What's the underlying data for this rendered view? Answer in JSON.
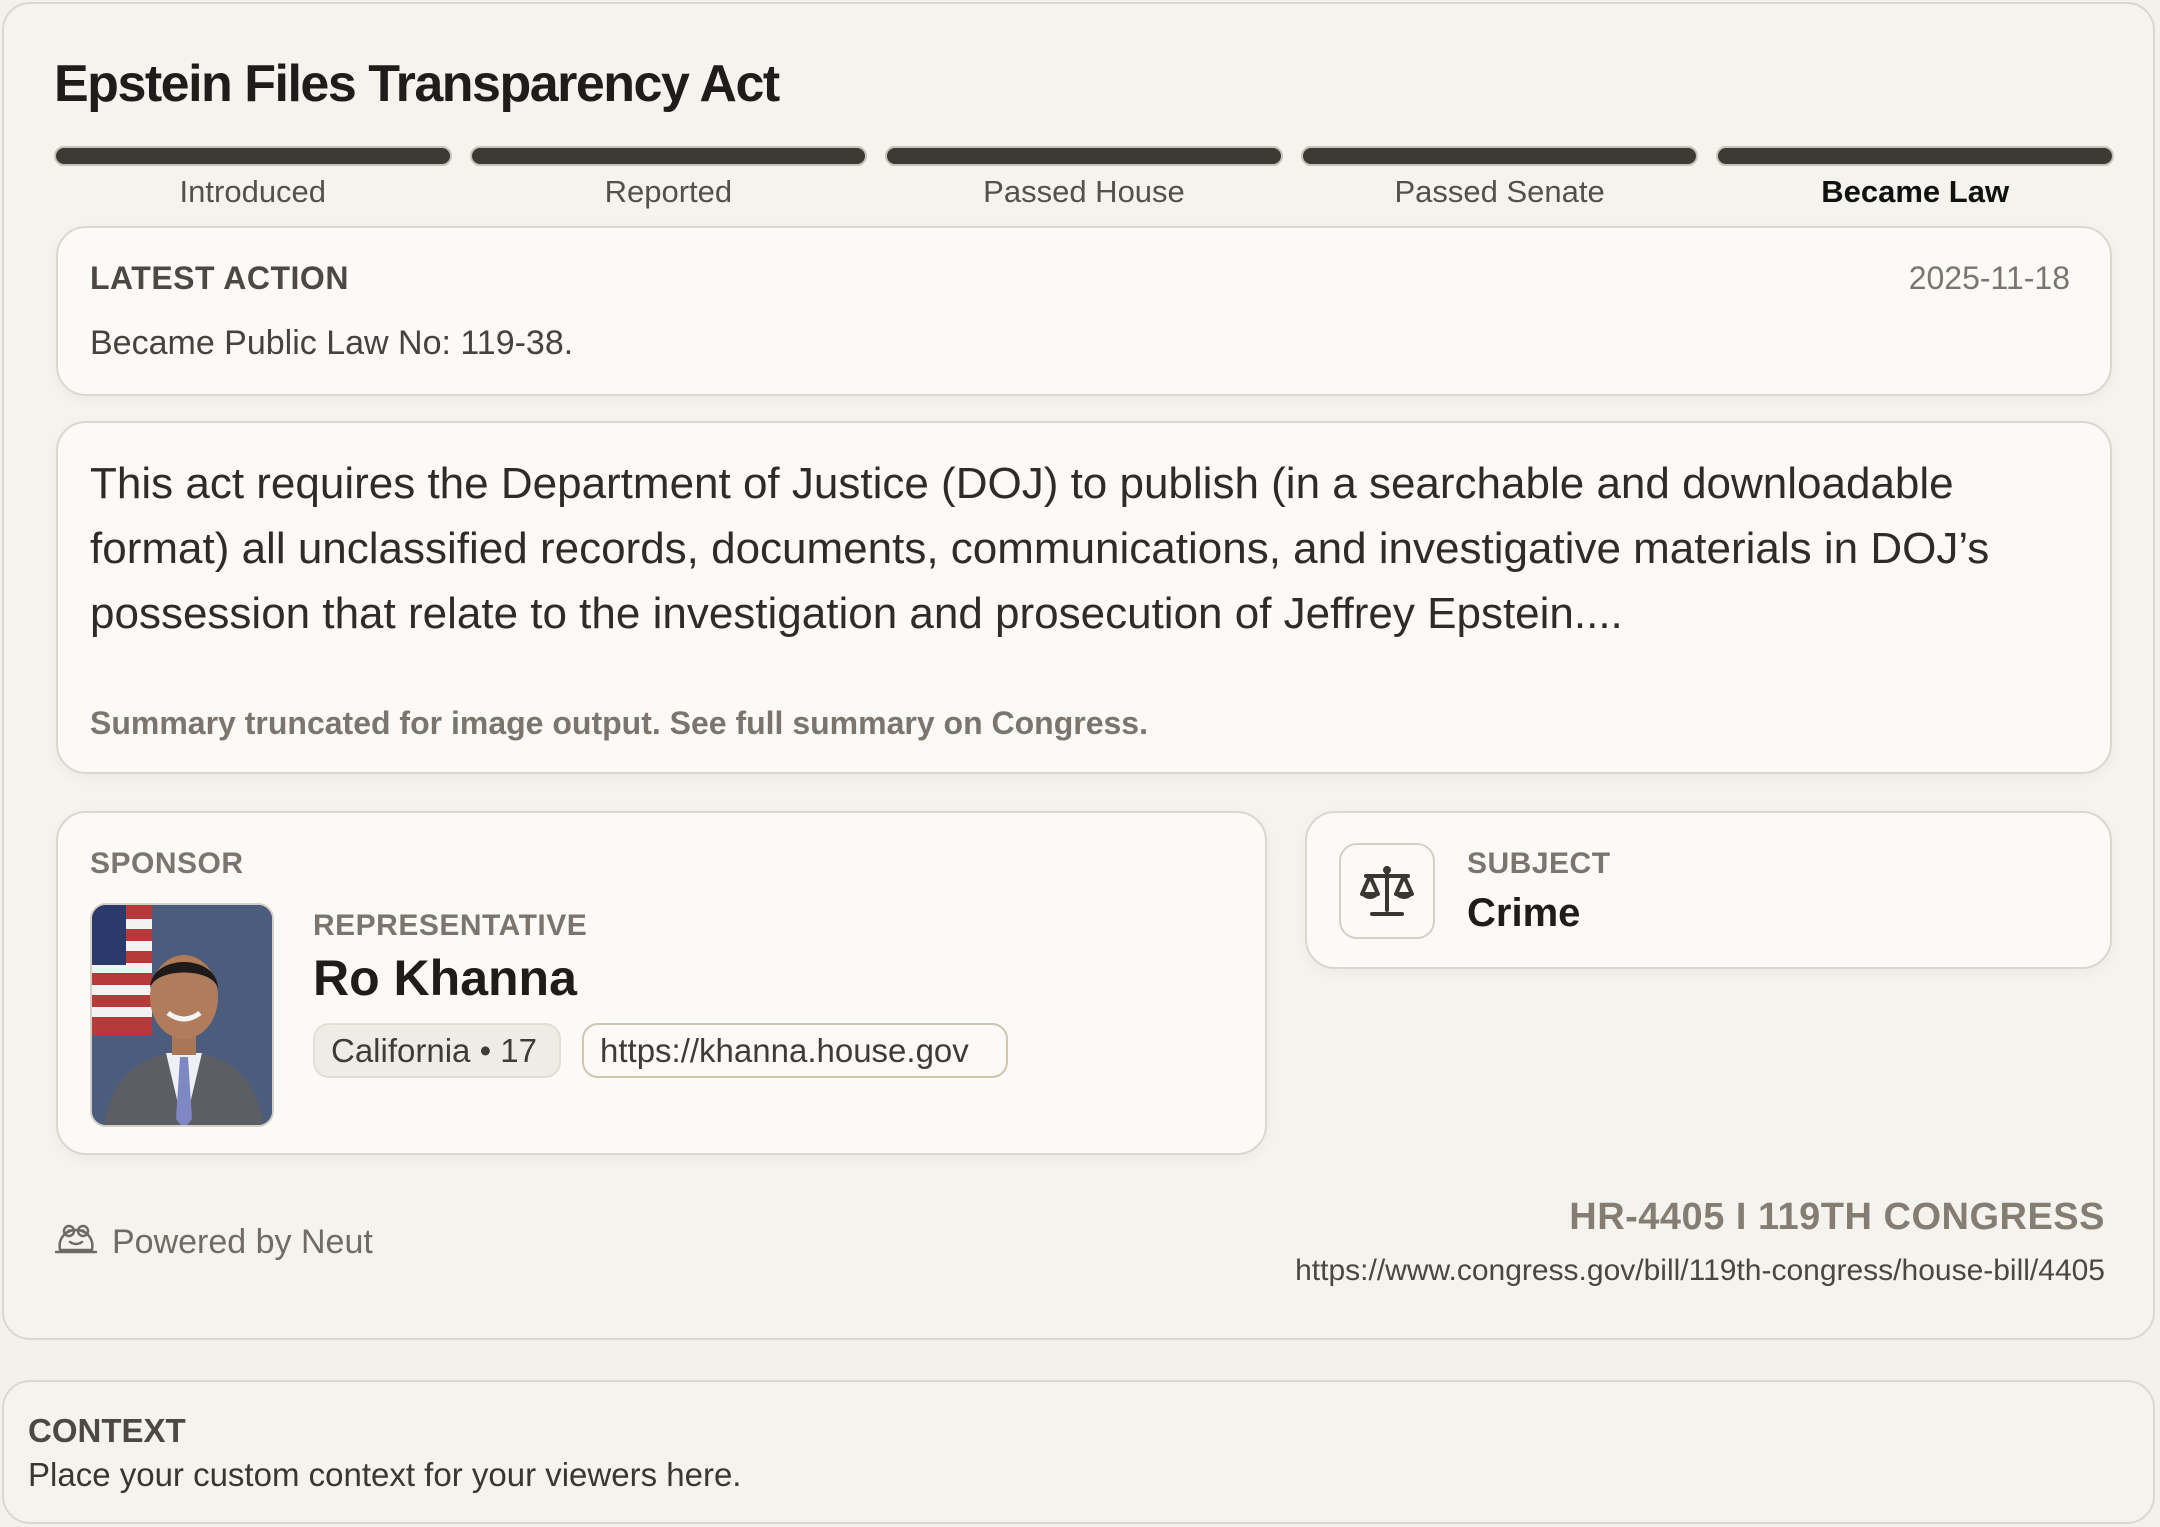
{
  "bill": {
    "title": "Epstein Files Transparency Act",
    "stages": [
      {
        "label": "Introduced"
      },
      {
        "label": "Reported"
      },
      {
        "label": "Passed House"
      },
      {
        "label": "Passed Senate"
      },
      {
        "label": "Became Law"
      }
    ],
    "current_stage": "Became Law",
    "latest_action": {
      "heading": "LATEST ACTION",
      "date": "2025-11-18",
      "text": "Became Public Law No: 119-38."
    },
    "summary": {
      "text": "This act requires the Department of Justice (DOJ) to publish (in a searchable and downloadable format) all unclassified records, documents, communications, and investigative materials in DOJ’s possession that relate to the investigation and prosecution of Jeffrey Epstein....",
      "note": "Summary truncated for image output. See full summary on Congress."
    },
    "sponsor": {
      "heading": "SPONSOR",
      "role": "REPRESENTATIVE",
      "name": "Ro Khanna",
      "district": "California • 17",
      "website": "https://khanna.house.gov"
    },
    "subject": {
      "heading": "SUBJECT",
      "value": "Crime",
      "icon": "scales-of-justice-icon"
    },
    "footer": {
      "powered_by": "Powered by Neut",
      "powered_icon": "neut-frog-icon",
      "bill_id": "HR-4405 I 119TH CONGRESS",
      "url": "https://www.congress.gov/bill/119th-congress/house-bill/4405"
    }
  },
  "context": {
    "heading": "CONTEXT",
    "text": "Place your custom context for your viewers here."
  },
  "colors": {
    "page_background": "#f3f1ec",
    "card_background": "#fbfaf7",
    "progress_fill": "#3d3934",
    "muted_text": "#7b756d"
  }
}
